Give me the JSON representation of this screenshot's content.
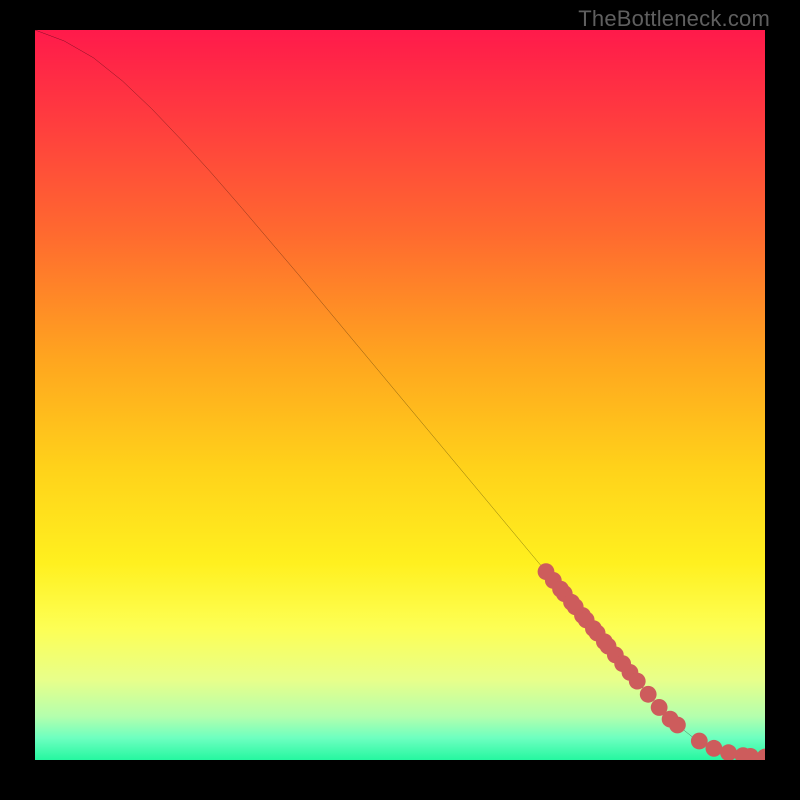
{
  "watermark": "TheBottleneck.com",
  "chart_data": {
    "type": "line",
    "title": "",
    "xlabel": "",
    "ylabel": "",
    "xlim": [
      0,
      100
    ],
    "ylim": [
      0,
      100
    ],
    "grid": false,
    "legend": false,
    "series": [
      {
        "name": "curve",
        "color": "#000000",
        "x": [
          0,
          4,
          8,
          12,
          16,
          20,
          24,
          28,
          32,
          36,
          40,
          44,
          48,
          52,
          56,
          60,
          64,
          68,
          72,
          76,
          80,
          84,
          86,
          88,
          90,
          92,
          94,
          96,
          98,
          100
        ],
        "y": [
          100,
          98.5,
          96.2,
          93.0,
          89.2,
          85.0,
          80.6,
          76.0,
          71.3,
          66.6,
          61.8,
          57.0,
          52.2,
          47.4,
          42.6,
          37.8,
          33.0,
          28.2,
          23.4,
          18.6,
          13.8,
          9.0,
          6.8,
          4.8,
          3.2,
          2.0,
          1.2,
          0.7,
          0.5,
          0.4
        ]
      }
    ],
    "points": {
      "name": "markers",
      "color": "#cd5c5c",
      "x": [
        70,
        71,
        72,
        72.5,
        73.5,
        74,
        75,
        75.5,
        76.5,
        77,
        78,
        78.5,
        79.5,
        80.5,
        81.5,
        82.5,
        84,
        85.5,
        87,
        88,
        91,
        93,
        95,
        97,
        98,
        100
      ],
      "y": [
        25.8,
        24.6,
        23.4,
        22.8,
        21.6,
        21.0,
        19.8,
        19.2,
        18.0,
        17.4,
        16.2,
        15.6,
        14.4,
        13.2,
        12.0,
        10.8,
        9.0,
        7.2,
        5.6,
        4.8,
        2.6,
        1.6,
        1.0,
        0.6,
        0.5,
        0.4
      ]
    },
    "gradient_stops": [
      {
        "pct": 0,
        "color": "#ff1a4b"
      },
      {
        "pct": 12,
        "color": "#ff3b3f"
      },
      {
        "pct": 28,
        "color": "#ff6a2f"
      },
      {
        "pct": 45,
        "color": "#ffa51f"
      },
      {
        "pct": 60,
        "color": "#ffd21a"
      },
      {
        "pct": 73,
        "color": "#fff01f"
      },
      {
        "pct": 82,
        "color": "#fdff55"
      },
      {
        "pct": 89,
        "color": "#e8ff8a"
      },
      {
        "pct": 94,
        "color": "#b4ffad"
      },
      {
        "pct": 97,
        "color": "#6dffc0"
      },
      {
        "pct": 100,
        "color": "#25f7a0"
      }
    ]
  }
}
